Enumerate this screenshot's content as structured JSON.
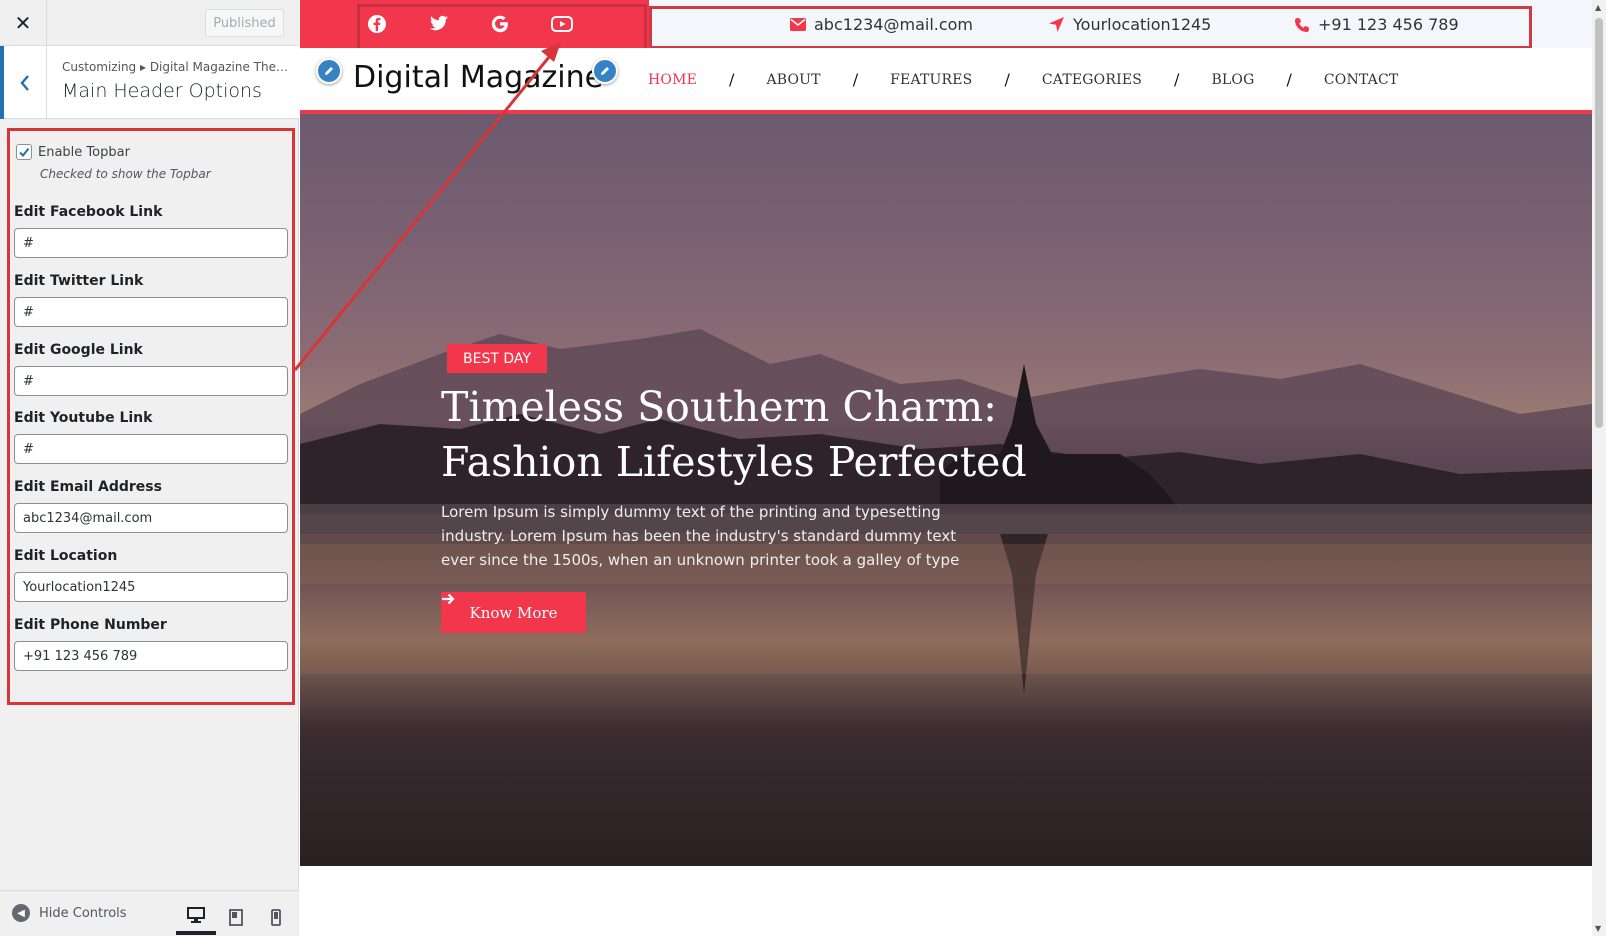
{
  "sidebar": {
    "close_glyph": "✕",
    "publish_label": "Published",
    "breadcrumb": "Customizing ▸ Digital Magazine The…",
    "section_title": "Main Header Options",
    "topbar_checkbox_label": "Enable Topbar",
    "topbar_checkbox_checked": true,
    "topbar_checkbox_desc": "Checked to show the Topbar",
    "fields": [
      {
        "label": "Edit Facebook Link",
        "value": "#"
      },
      {
        "label": "Edit Twitter Link",
        "value": "#"
      },
      {
        "label": "Edit Google Link",
        "value": "#"
      },
      {
        "label": "Edit Youtube Link",
        "value": "#"
      },
      {
        "label": "Edit Email Address",
        "value": "abc1234@mail.com"
      },
      {
        "label": "Edit Location",
        "value": "Yourlocation1245"
      },
      {
        "label": "Edit Phone Number",
        "value": "+91 123 456 789"
      }
    ],
    "hide_controls_label": "Hide Controls",
    "devices": [
      "desktop",
      "tablet",
      "mobile"
    ],
    "active_device": "desktop"
  },
  "topbar": {
    "social_icons": [
      "facebook-icon",
      "twitter-icon",
      "google-icon",
      "youtube-icon"
    ],
    "email": "abc1234@mail.com",
    "location": "Yourlocation1245",
    "phone": "+91 123 456 789"
  },
  "header": {
    "site_title": "Digital Magazine",
    "nav": [
      "HOME",
      "ABOUT",
      "FEATURES",
      "CATEGORIES",
      "BLOG",
      "CONTACT"
    ],
    "active_nav": "HOME",
    "separator": "/"
  },
  "hero": {
    "tag": "BEST DAY",
    "title_line1": "Timeless Southern Charm:",
    "title_line2": "Fashion Lifestyles Perfected",
    "text": "Lorem Ipsum is simply dummy text of the printing and typesetting industry. Lorem Ipsum has been the industry's standard dummy text ever since the 1500s, when an unknown printer took a galley of type",
    "button_label": "Know More"
  },
  "colors": {
    "accent": "#f2374c",
    "wp_blue": "#2271b1",
    "annotation_red": "#d63638"
  }
}
